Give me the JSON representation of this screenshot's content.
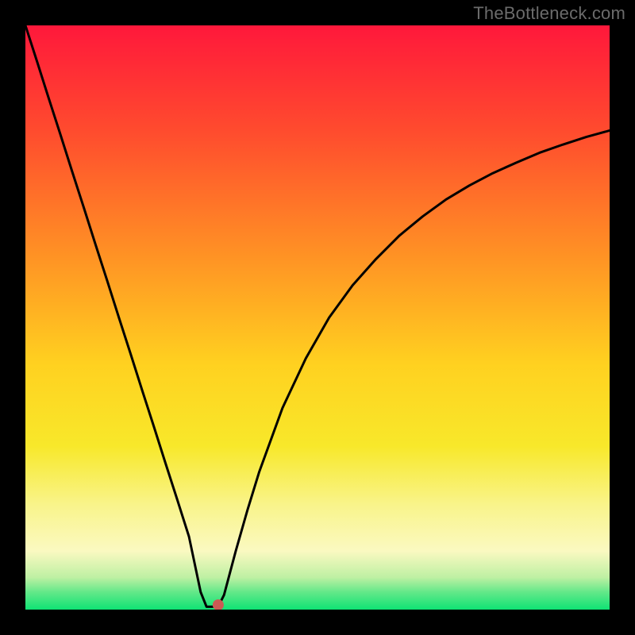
{
  "watermark": "TheBottleneck.com",
  "chart_data": {
    "type": "line",
    "title": "",
    "xlabel": "",
    "ylabel": "",
    "xlim": [
      0,
      100
    ],
    "ylim": [
      0,
      100
    ],
    "x": [
      0,
      2,
      4,
      6,
      8,
      10,
      12,
      14,
      16,
      18,
      20,
      22,
      24,
      26,
      28,
      30,
      31,
      32,
      33,
      34,
      36,
      38,
      40,
      44,
      48,
      52,
      56,
      60,
      64,
      68,
      72,
      76,
      80,
      84,
      88,
      92,
      96,
      100
    ],
    "values": [
      100,
      93.8,
      87.5,
      81.3,
      75.0,
      68.8,
      62.5,
      56.3,
      50.0,
      43.8,
      37.5,
      31.3,
      25.0,
      18.8,
      12.5,
      3.0,
      0.5,
      0.5,
      0.5,
      2.5,
      10.0,
      17.0,
      23.5,
      34.5,
      43.0,
      50.0,
      55.5,
      60.0,
      64.0,
      67.3,
      70.2,
      72.6,
      74.7,
      76.5,
      78.2,
      79.6,
      80.9,
      82.0
    ],
    "marker": {
      "x": 33.0,
      "y": 0.8
    },
    "background_gradient": {
      "stops": [
        {
          "offset": 0.0,
          "color": "#ff183b"
        },
        {
          "offset": 0.18,
          "color": "#ff4b2e"
        },
        {
          "offset": 0.4,
          "color": "#ff9424"
        },
        {
          "offset": 0.58,
          "color": "#ffd120"
        },
        {
          "offset": 0.72,
          "color": "#f8e82a"
        },
        {
          "offset": 0.82,
          "color": "#f9f48a"
        },
        {
          "offset": 0.9,
          "color": "#faf9c1"
        },
        {
          "offset": 0.945,
          "color": "#bef0a3"
        },
        {
          "offset": 0.97,
          "color": "#63e889"
        },
        {
          "offset": 1.0,
          "color": "#0fe374"
        }
      ]
    }
  }
}
